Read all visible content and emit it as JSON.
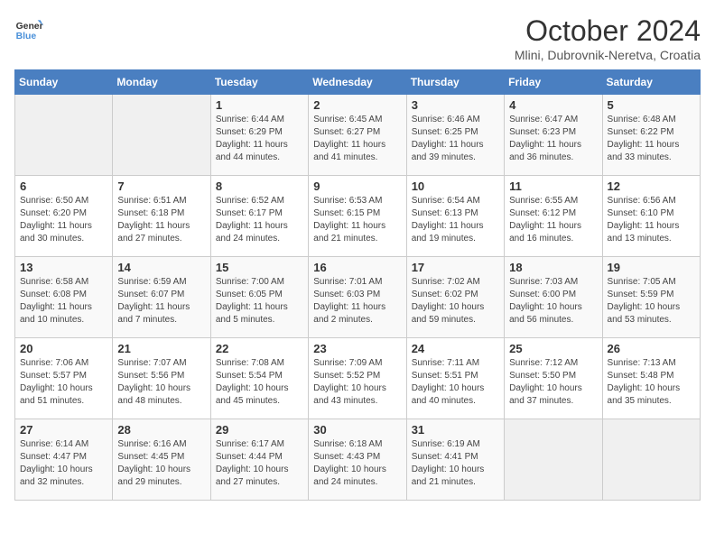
{
  "header": {
    "logo_line1": "General",
    "logo_line2": "Blue",
    "month": "October 2024",
    "location": "Mlini, Dubrovnik-Neretva, Croatia"
  },
  "weekdays": [
    "Sunday",
    "Monday",
    "Tuesday",
    "Wednesday",
    "Thursday",
    "Friday",
    "Saturday"
  ],
  "weeks": [
    [
      {
        "day": "",
        "info": ""
      },
      {
        "day": "",
        "info": ""
      },
      {
        "day": "1",
        "info": "Sunrise: 6:44 AM\nSunset: 6:29 PM\nDaylight: 11 hours and 44 minutes."
      },
      {
        "day": "2",
        "info": "Sunrise: 6:45 AM\nSunset: 6:27 PM\nDaylight: 11 hours and 41 minutes."
      },
      {
        "day": "3",
        "info": "Sunrise: 6:46 AM\nSunset: 6:25 PM\nDaylight: 11 hours and 39 minutes."
      },
      {
        "day": "4",
        "info": "Sunrise: 6:47 AM\nSunset: 6:23 PM\nDaylight: 11 hours and 36 minutes."
      },
      {
        "day": "5",
        "info": "Sunrise: 6:48 AM\nSunset: 6:22 PM\nDaylight: 11 hours and 33 minutes."
      }
    ],
    [
      {
        "day": "6",
        "info": "Sunrise: 6:50 AM\nSunset: 6:20 PM\nDaylight: 11 hours and 30 minutes."
      },
      {
        "day": "7",
        "info": "Sunrise: 6:51 AM\nSunset: 6:18 PM\nDaylight: 11 hours and 27 minutes."
      },
      {
        "day": "8",
        "info": "Sunrise: 6:52 AM\nSunset: 6:17 PM\nDaylight: 11 hours and 24 minutes."
      },
      {
        "day": "9",
        "info": "Sunrise: 6:53 AM\nSunset: 6:15 PM\nDaylight: 11 hours and 21 minutes."
      },
      {
        "day": "10",
        "info": "Sunrise: 6:54 AM\nSunset: 6:13 PM\nDaylight: 11 hours and 19 minutes."
      },
      {
        "day": "11",
        "info": "Sunrise: 6:55 AM\nSunset: 6:12 PM\nDaylight: 11 hours and 16 minutes."
      },
      {
        "day": "12",
        "info": "Sunrise: 6:56 AM\nSunset: 6:10 PM\nDaylight: 11 hours and 13 minutes."
      }
    ],
    [
      {
        "day": "13",
        "info": "Sunrise: 6:58 AM\nSunset: 6:08 PM\nDaylight: 11 hours and 10 minutes."
      },
      {
        "day": "14",
        "info": "Sunrise: 6:59 AM\nSunset: 6:07 PM\nDaylight: 11 hours and 7 minutes."
      },
      {
        "day": "15",
        "info": "Sunrise: 7:00 AM\nSunset: 6:05 PM\nDaylight: 11 hours and 5 minutes."
      },
      {
        "day": "16",
        "info": "Sunrise: 7:01 AM\nSunset: 6:03 PM\nDaylight: 11 hours and 2 minutes."
      },
      {
        "day": "17",
        "info": "Sunrise: 7:02 AM\nSunset: 6:02 PM\nDaylight: 10 hours and 59 minutes."
      },
      {
        "day": "18",
        "info": "Sunrise: 7:03 AM\nSunset: 6:00 PM\nDaylight: 10 hours and 56 minutes."
      },
      {
        "day": "19",
        "info": "Sunrise: 7:05 AM\nSunset: 5:59 PM\nDaylight: 10 hours and 53 minutes."
      }
    ],
    [
      {
        "day": "20",
        "info": "Sunrise: 7:06 AM\nSunset: 5:57 PM\nDaylight: 10 hours and 51 minutes."
      },
      {
        "day": "21",
        "info": "Sunrise: 7:07 AM\nSunset: 5:56 PM\nDaylight: 10 hours and 48 minutes."
      },
      {
        "day": "22",
        "info": "Sunrise: 7:08 AM\nSunset: 5:54 PM\nDaylight: 10 hours and 45 minutes."
      },
      {
        "day": "23",
        "info": "Sunrise: 7:09 AM\nSunset: 5:52 PM\nDaylight: 10 hours and 43 minutes."
      },
      {
        "day": "24",
        "info": "Sunrise: 7:11 AM\nSunset: 5:51 PM\nDaylight: 10 hours and 40 minutes."
      },
      {
        "day": "25",
        "info": "Sunrise: 7:12 AM\nSunset: 5:50 PM\nDaylight: 10 hours and 37 minutes."
      },
      {
        "day": "26",
        "info": "Sunrise: 7:13 AM\nSunset: 5:48 PM\nDaylight: 10 hours and 35 minutes."
      }
    ],
    [
      {
        "day": "27",
        "info": "Sunrise: 6:14 AM\nSunset: 4:47 PM\nDaylight: 10 hours and 32 minutes."
      },
      {
        "day": "28",
        "info": "Sunrise: 6:16 AM\nSunset: 4:45 PM\nDaylight: 10 hours and 29 minutes."
      },
      {
        "day": "29",
        "info": "Sunrise: 6:17 AM\nSunset: 4:44 PM\nDaylight: 10 hours and 27 minutes."
      },
      {
        "day": "30",
        "info": "Sunrise: 6:18 AM\nSunset: 4:43 PM\nDaylight: 10 hours and 24 minutes."
      },
      {
        "day": "31",
        "info": "Sunrise: 6:19 AM\nSunset: 4:41 PM\nDaylight: 10 hours and 21 minutes."
      },
      {
        "day": "",
        "info": ""
      },
      {
        "day": "",
        "info": ""
      }
    ]
  ]
}
